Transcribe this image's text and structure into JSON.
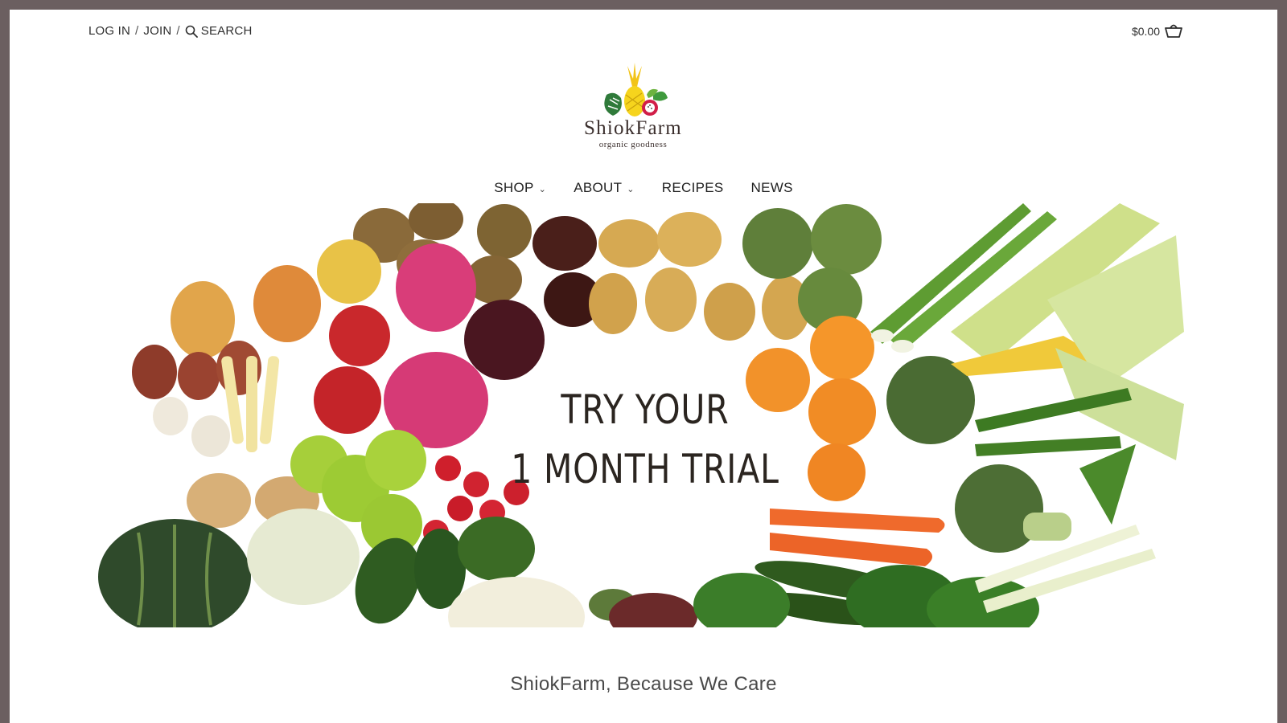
{
  "header": {
    "login_label": "LOG IN",
    "separator": "/",
    "join_label": "JOIN",
    "search_label": "SEARCH",
    "cart_total": "$0.00"
  },
  "logo": {
    "name": "ShiokFarm",
    "tagline": "organic goodness"
  },
  "nav": {
    "items": [
      {
        "label": "SHOP",
        "has_dropdown": true
      },
      {
        "label": "ABOUT",
        "has_dropdown": true
      },
      {
        "label": "RECIPES",
        "has_dropdown": false
      },
      {
        "label": "NEWS",
        "has_dropdown": false
      }
    ]
  },
  "hero": {
    "line1": "TRY YOUR",
    "line2": "1 MONTH TRIAL"
  },
  "intro": {
    "heading": "ShiokFarm, Because We Care"
  },
  "colors": {
    "frame": "#6b5f60",
    "background": "#ffffff",
    "text": "#2b2b2b"
  },
  "icons": [
    "search-icon",
    "cart-icon",
    "chevron-down-icon"
  ]
}
